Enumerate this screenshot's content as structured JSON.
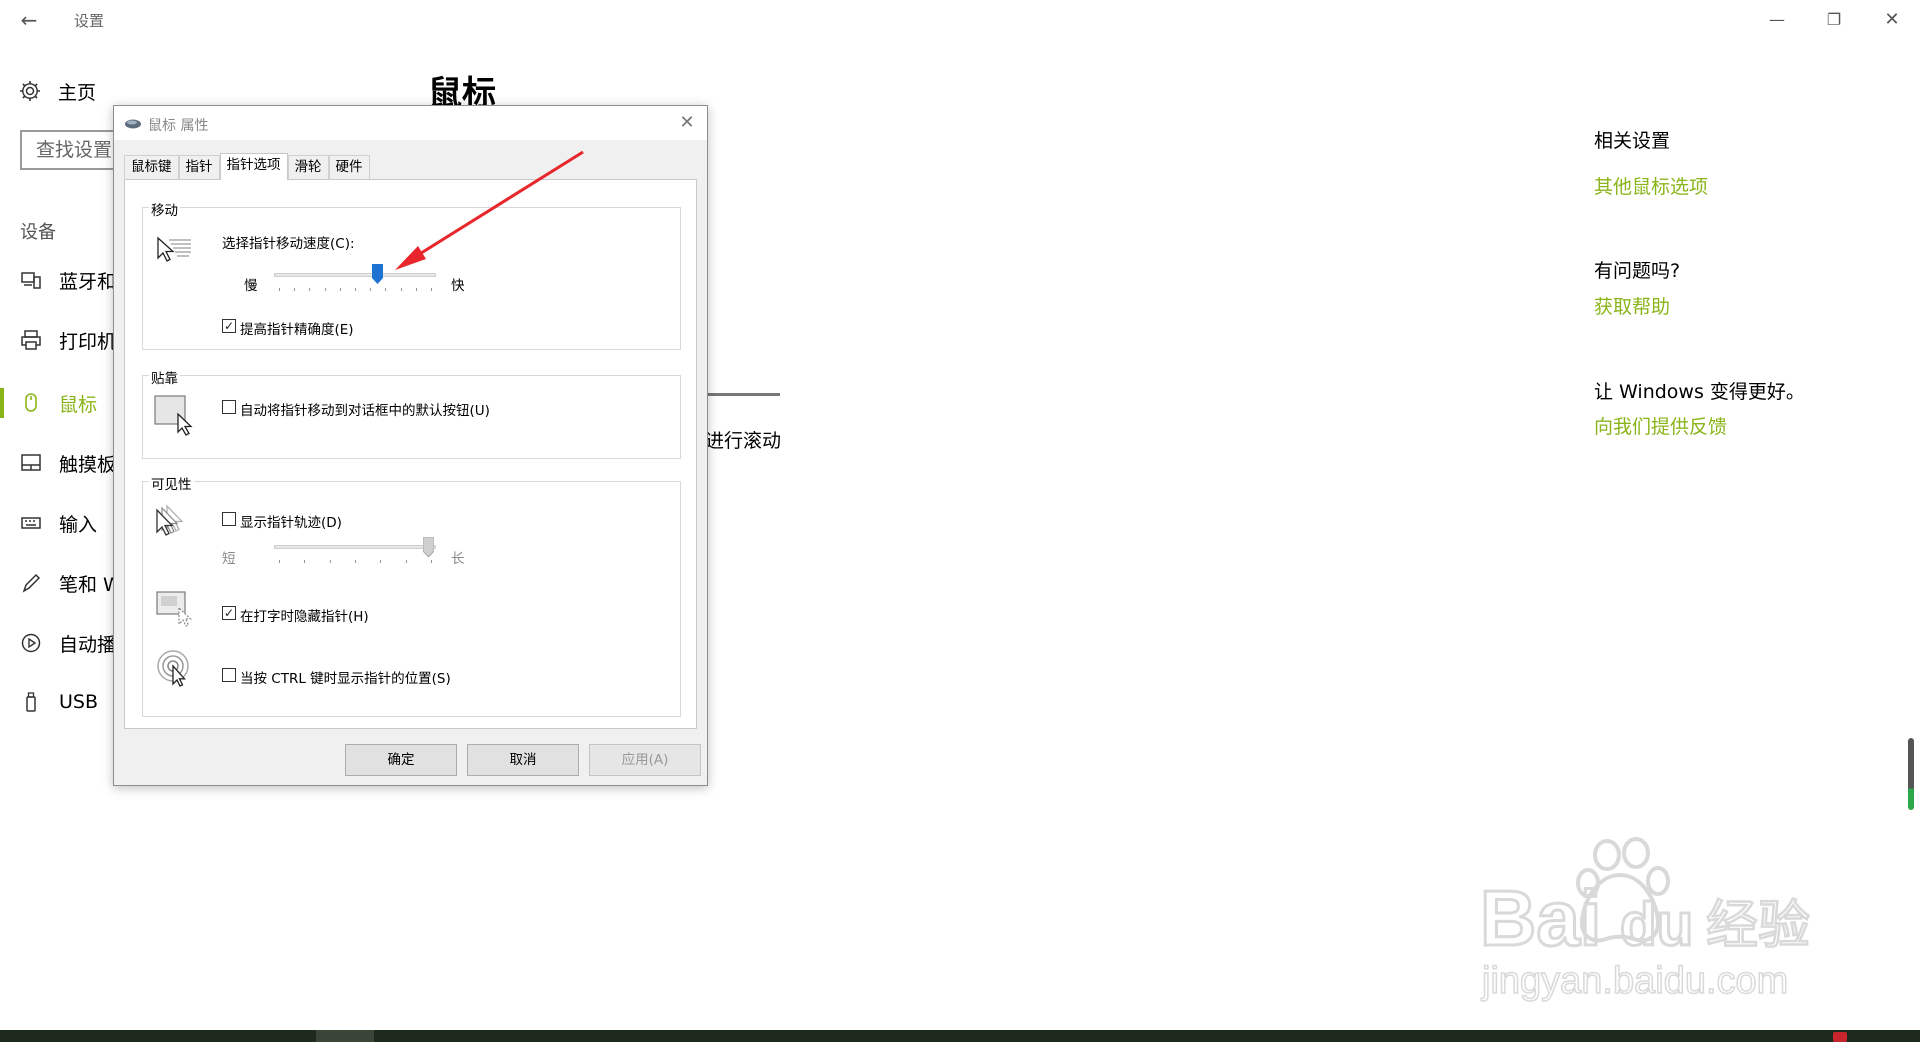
{
  "app": {
    "title": "设置"
  },
  "nav": {
    "home": "主页",
    "search_placeholder": "查找设置",
    "section": "设备",
    "items": [
      {
        "label": "蓝牙和",
        "icon": "bluetooth-devices-icon"
      },
      {
        "label": "打印机",
        "icon": "printer-icon"
      },
      {
        "label": "鼠标",
        "icon": "mouse-icon",
        "active": true
      },
      {
        "label": "触摸板",
        "icon": "touchpad-icon"
      },
      {
        "label": "输入",
        "icon": "keyboard-icon"
      },
      {
        "label": "笔和 W",
        "icon": "pen-icon"
      },
      {
        "label": "自动播",
        "icon": "autoplay-icon"
      },
      {
        "label": "USB",
        "icon": "usb-icon"
      }
    ]
  },
  "main": {
    "title": "鼠标",
    "partial_text": "进行滚动"
  },
  "related": {
    "title": "相关设置",
    "link": "其他鼠标选项",
    "help_title": "有问题吗?",
    "help_link": "获取帮助",
    "feedback_title": "让 Windows 变得更好。",
    "feedback_link": "向我们提供反馈"
  },
  "dialog": {
    "title": "鼠标 属性",
    "tabs": [
      "鼠标键",
      "指针",
      "指针选项",
      "滑轮",
      "硬件"
    ],
    "active_tab": "指针选项",
    "motion": {
      "group_label": "移动",
      "speed_label": "选择指针移动速度(C):",
      "slow": "慢",
      "fast": "快",
      "speed_level": 0.65,
      "precision_label": "提高指针精确度(E)",
      "precision_checked": true
    },
    "snap": {
      "group_label": "贴靠",
      "label": "自动将指针移动到对话框中的默认按钮(U)",
      "checked": false
    },
    "visibility": {
      "group_label": "可见性",
      "trails_label": "显示指针轨迹(D)",
      "trails_checked": false,
      "short": "短",
      "long": "长",
      "trails_level": 1.0,
      "hide_typing_label": "在打字时隐藏指针(H)",
      "hide_typing_checked": true,
      "ctrl_label": "当按 CTRL 键时显示指针的位置(S)",
      "ctrl_checked": false
    },
    "buttons": {
      "ok": "确定",
      "cancel": "取消",
      "apply": "应用(A)"
    }
  },
  "watermark": {
    "logo": "Baidu经验",
    "url": "jingyan.baidu.com"
  },
  "colors": {
    "accent": "#8ab51a",
    "arrow": "#e8262b",
    "thumb": "#1e72d2"
  }
}
